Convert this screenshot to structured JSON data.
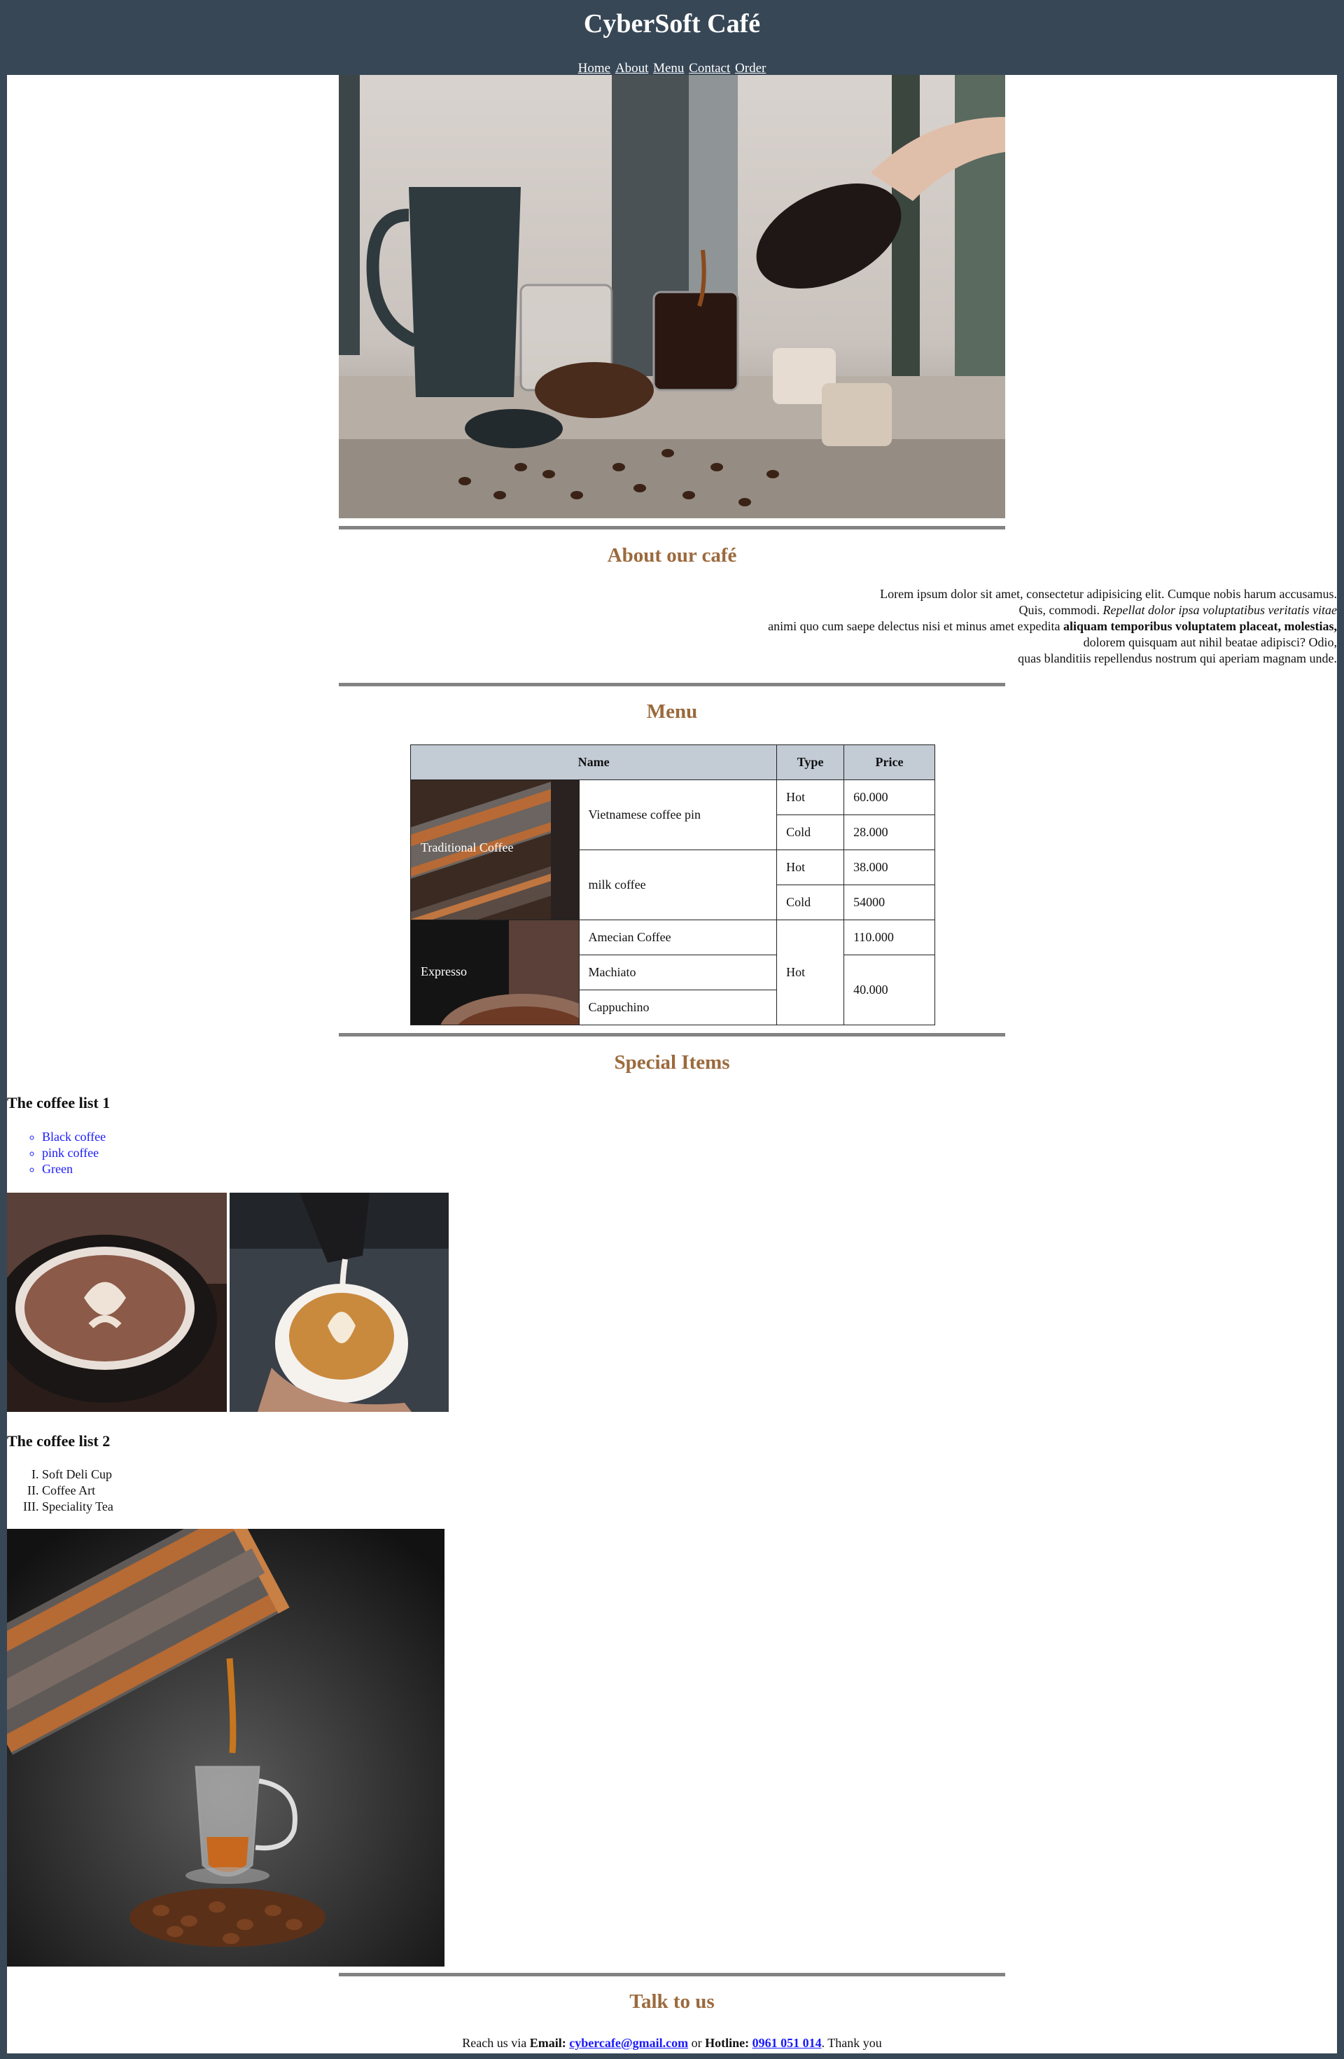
{
  "header": {
    "title": "CyberSoft Café",
    "nav": [
      "Home",
      "About",
      "Menu",
      "Contact",
      "Order"
    ]
  },
  "hero": {
    "icon": "coffee-pour-photo"
  },
  "about": {
    "title": "About our café",
    "lines": [
      "Lorem ipsum dolor sit amet, consectetur adipisicing elit. Cumque nobis harum accusamus.",
      "Quis, commodi. ",
      "Repellat dolor ipsa voluptatibus veritatis vitae",
      "animi quo cum saepe delectus nisi et minus amet expedita ",
      "aliquam temporibus voluptatem placeat, molestias,",
      "dolorem quisquam aut nihil beatae adipisci? Odio,",
      "quas blanditiis repellendus nostrum qui aperiam magnam unde."
    ]
  },
  "menu": {
    "title": "Menu",
    "headers": [
      "Name",
      "Type",
      "Price"
    ],
    "categories": [
      "Traditional Coffee",
      "Expresso"
    ],
    "items": [
      "Vietnamese coffee pin",
      "milk coffee",
      "Amecian Coffee",
      "Machiato",
      "Cappuchino"
    ],
    "types": [
      "Hot",
      "Cold",
      "Hot",
      "Cold",
      "Hot"
    ],
    "prices": [
      "60.000",
      "28.000",
      "38.000",
      "54000",
      "110.000",
      "40.000"
    ]
  },
  "special": {
    "title": "Special Items",
    "list1_title": "The coffee list 1",
    "list1": [
      "Black coffee",
      "pink coffee",
      "Green"
    ],
    "list2_title": "The coffee list 2",
    "list2": [
      "Soft Deli Cup",
      "Coffee Art",
      "Speciality Tea"
    ]
  },
  "contact": {
    "title": "Talk to us",
    "prefix": "Reach us via ",
    "email_label": "Email:",
    "email": "cybercafe@gmail.com",
    "middle": " or ",
    "hotline_label": "Hotline:",
    "hotline": "0961 051 014",
    "suffix": ". Thank you"
  }
}
